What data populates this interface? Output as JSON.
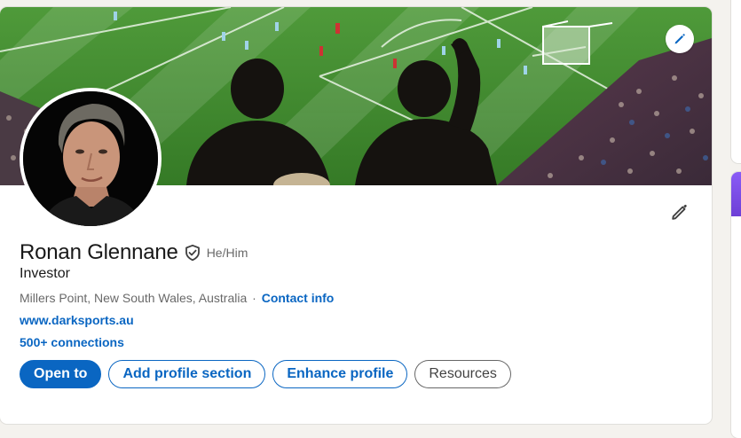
{
  "profile": {
    "name": "Ronan Glennane",
    "pronouns": "He/Him",
    "headline": "Investor",
    "location": "Millers Point, New South Wales, Australia",
    "separator": "·",
    "contact_info": "Contact info",
    "website": "www.darksports.au",
    "connections": "500+ connections"
  },
  "actions": {
    "open_to": "Open to",
    "add_section": "Add profile section",
    "enhance": "Enhance profile",
    "resources": "Resources"
  },
  "icons": {
    "cover_edit": "pencil-icon",
    "intro_edit": "pencil-icon",
    "verified": "shield-check-icon"
  },
  "colors": {
    "accent": "#0a66c2",
    "page_bg": "#f4f2ee",
    "pitch": "#3f8a2e"
  }
}
